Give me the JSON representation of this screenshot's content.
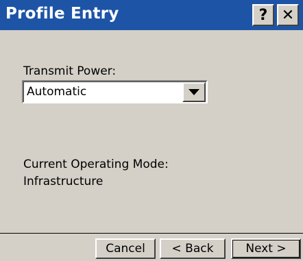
{
  "window": {
    "title": "Profile Entry",
    "title_color": "#1e54a6",
    "help_label": "?",
    "close_label": "✕"
  },
  "form": {
    "transmit_power_label": "Transmit Power:",
    "transmit_power_value": "Automatic",
    "operating_mode_label": "Current Operating Mode:",
    "operating_mode_value": "Infrastructure"
  },
  "buttons": {
    "cancel": "Cancel",
    "back": "< Back",
    "next": "Next >"
  }
}
